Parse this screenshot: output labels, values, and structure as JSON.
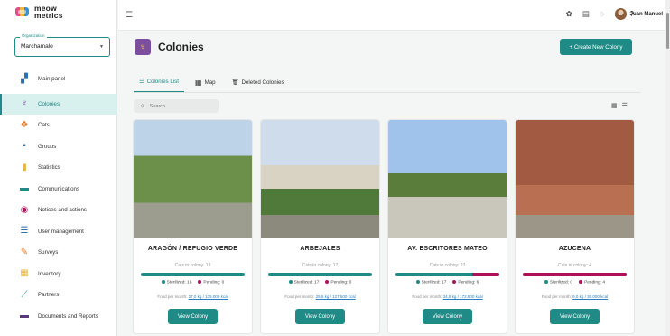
{
  "app": {
    "logo_line1": "meow",
    "logo_line2": "metrics",
    "org_label": "Organization",
    "org_value": "Marchamalo"
  },
  "sidebar": {
    "items": [
      {
        "label": "Main panel",
        "icon": "main-panel-icon",
        "glyph": "▞",
        "color": "#2f6fb0"
      },
      {
        "label": "Colonies",
        "icon": "trophy-icon",
        "glyph": "♆",
        "color": "#7c4f9e",
        "active": true
      },
      {
        "label": "Cats",
        "icon": "paw-icon",
        "glyph": "❖",
        "color": "#e07a2a"
      },
      {
        "label": "Groups",
        "icon": "group-icon",
        "glyph": "▪",
        "color": "#2f6fb0"
      },
      {
        "label": "Statistics",
        "icon": "bar-chart-icon",
        "glyph": "▮",
        "color": "#e8b43a"
      },
      {
        "label": "Communications",
        "icon": "communications-icon",
        "glyph": "▬",
        "color": "#1f8a86"
      },
      {
        "label": "Notices and actions",
        "icon": "notice-icon",
        "glyph": "◉",
        "color": "#b0125a"
      },
      {
        "label": "User management",
        "icon": "list-icon",
        "glyph": "☰",
        "color": "#2f6fb0"
      },
      {
        "label": "Surveys",
        "icon": "survey-icon",
        "glyph": "✎",
        "color": "#e07a2a"
      },
      {
        "label": "Inventory",
        "icon": "inventory-icon",
        "glyph": "▦",
        "color": "#e8b43a"
      },
      {
        "label": "Partners",
        "icon": "handshake-icon",
        "glyph": "⟋",
        "color": "#1f8a86"
      },
      {
        "label": "Documents and Reports",
        "icon": "documents-icon",
        "glyph": "▬",
        "color": "#5a3a7a"
      }
    ]
  },
  "header": {
    "user_name": "Juan Manuel"
  },
  "main": {
    "title": "Colonies",
    "create_label": "+ Create New Colony",
    "tabs": [
      {
        "label": "Colonies List",
        "icon": "list-icon"
      },
      {
        "label": "Map",
        "icon": "grid-map-icon"
      },
      {
        "label": "Deleted Colonies",
        "icon": "trash-icon"
      }
    ],
    "search_placeholder": "Search"
  },
  "colors": {
    "accent": "#1f8a86",
    "pending": "#b0125a",
    "sterilized": "#1f8a86"
  },
  "cards": [
    {
      "name": "ARAGÓN / REFUGIO VERDE",
      "cats_text": "Cats in colony: 18",
      "sterilized_text": "Sterilized: 18",
      "pending_text": "Pending: 0",
      "sterilized_fraction": 1.0,
      "food_prefix": "Food per month: ",
      "food_link": "27,0 kg / 135.000 kcal",
      "button": "View Colony"
    },
    {
      "name": "ARBEJALES",
      "cats_text": "Cats in colony: 17",
      "sterilized_text": "Sterilized: 17",
      "pending_text": "Pending: 0",
      "sterilized_fraction": 1.0,
      "food_prefix": "Food per month: ",
      "food_link": "25,5 kg / 127.500 kcal",
      "button": "View Colony"
    },
    {
      "name": "AV. ESCRITORES MATEO",
      "cats_text": "Cats in colony: 23",
      "sterilized_text": "Sterilized: 17",
      "pending_text": "Pending: 6",
      "sterilized_fraction": 0.74,
      "food_prefix": "Food per month: ",
      "food_link": "34,5 kg / 172.500 kcal",
      "button": "View Colony"
    },
    {
      "name": "AZUCENA",
      "cats_text": "Cats in colony: 4",
      "sterilized_text": "Sterilized: 0",
      "pending_text": "Pending: 4",
      "sterilized_fraction": 0.0,
      "food_prefix": "Food per month: ",
      "food_link": "6,0 kg / 30.000 kcal",
      "button": "View Colony"
    }
  ]
}
